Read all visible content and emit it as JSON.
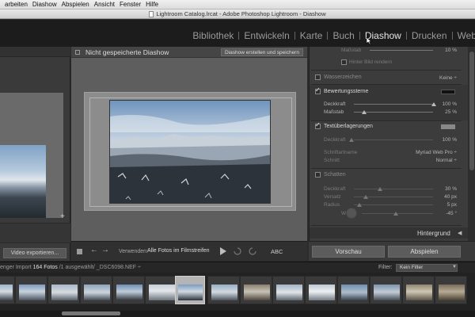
{
  "menu": [
    "arbeiten",
    "Diashow",
    "Abspielen",
    "Ansicht",
    "Fenster",
    "Hilfe"
  ],
  "window_title": "Lightroom Catalog.lrcat - Adobe Photoshop Lightroom - Diashow",
  "modules": [
    {
      "label": "Bibliothek",
      "active": false
    },
    {
      "label": "Entwickeln",
      "active": false
    },
    {
      "label": "Karte",
      "active": false
    },
    {
      "label": "Buch",
      "active": false
    },
    {
      "label": "Diashow",
      "active": true
    },
    {
      "label": "Drucken",
      "active": false
    },
    {
      "label": "Web",
      "active": false
    }
  ],
  "left": {
    "export_label": "Video exportieren...",
    "plus": "+"
  },
  "center": {
    "title": "Nicht gespeicherte Diashow",
    "create_label": "Diashow erstellen und speichern"
  },
  "toolbar": {
    "use_label": "Verwenden:",
    "use_value": "Alle Fotos im Filmstreifen",
    "abc": "ABC",
    "prev_icon": "arrow-left",
    "next_icon": "arrow-right",
    "play_icon": "play"
  },
  "right": {
    "top": {
      "scale_label": "Maßstab",
      "scale_value": "10 %",
      "behind_label": "Hinter Bild rendern"
    },
    "watermark": {
      "label": "Wasserzeichen",
      "value": "Keine ÷"
    },
    "rating": {
      "label": "Bewertungssterne",
      "opacity_label": "Deckkraft",
      "opacity_value": "100 %",
      "scale_label": "Maßstab",
      "scale_value": "25 %"
    },
    "text": {
      "label": "Textüberlagerungen",
      "opacity_label": "Deckkraft",
      "opacity_value": "100 %",
      "font_label": "Schriftartname",
      "font_value": "Myriad Web Pro ÷",
      "style_label": "Schnitt",
      "style_value": "Normal ÷"
    },
    "shadow": {
      "label": "Schatten",
      "rows": [
        {
          "label": "Deckkraft",
          "value": "30 %"
        },
        {
          "label": "Versatz",
          "value": "40 px"
        },
        {
          "label": "Radius",
          "value": "5 px"
        },
        {
          "label": "Winkel",
          "value": "-45 °"
        }
      ]
    },
    "background": {
      "label": "Hintergrund"
    }
  },
  "buttons": {
    "preview": "Vorschau",
    "play": "Abspielen"
  },
  "filmstrip": {
    "source_prefix": "enger Import",
    "count": "164 Fotos",
    "source_rest": "/1 ausgewählt/ _DSC6098.NEF ÷",
    "filter_label": "Filter:",
    "filter_value": "Kein Filter"
  },
  "colors": {
    "accent_text": "#e6e6e6",
    "sky": "#8fb0d0",
    "snow": "#d8dde3",
    "forest": "#2a3138"
  }
}
